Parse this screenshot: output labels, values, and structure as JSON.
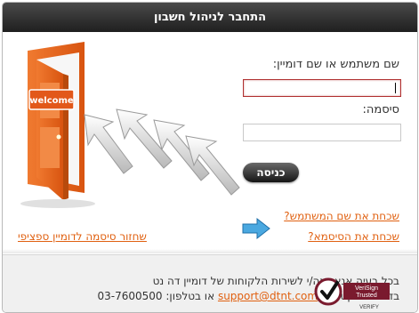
{
  "header": {
    "title": "התחבר לניהול חשבון"
  },
  "art": {
    "door_sign": "welcome"
  },
  "form": {
    "username_label": "שם משתמש או שם דומיין:",
    "username_value": "",
    "password_label": "סיסמה:",
    "password_value": "",
    "submit_label": "כניסה"
  },
  "links": {
    "forgot_username": "שכחת את שם המשתמש?",
    "forgot_password": "שכחת את הסיסמא?",
    "domain_password_recovery": "שחזור סיסמה לדומיין ספציפי"
  },
  "footer": {
    "line1": "בכל בעיה אנא פנה/י לשירות הלקוחות של דומיין דה נט",
    "line2_prefix": "בדואר אלקטרוני:",
    "email": "support@dtnt.com",
    "line2_middle": "או בטלפון:",
    "phone": "03-7600500",
    "badge_line1": "VeriSign",
    "badge_line2": "Trusted",
    "badge_verify": "VERIFY"
  },
  "colors": {
    "link": "#e06010",
    "door": "#e8641e",
    "header": "#2b2b2b"
  }
}
